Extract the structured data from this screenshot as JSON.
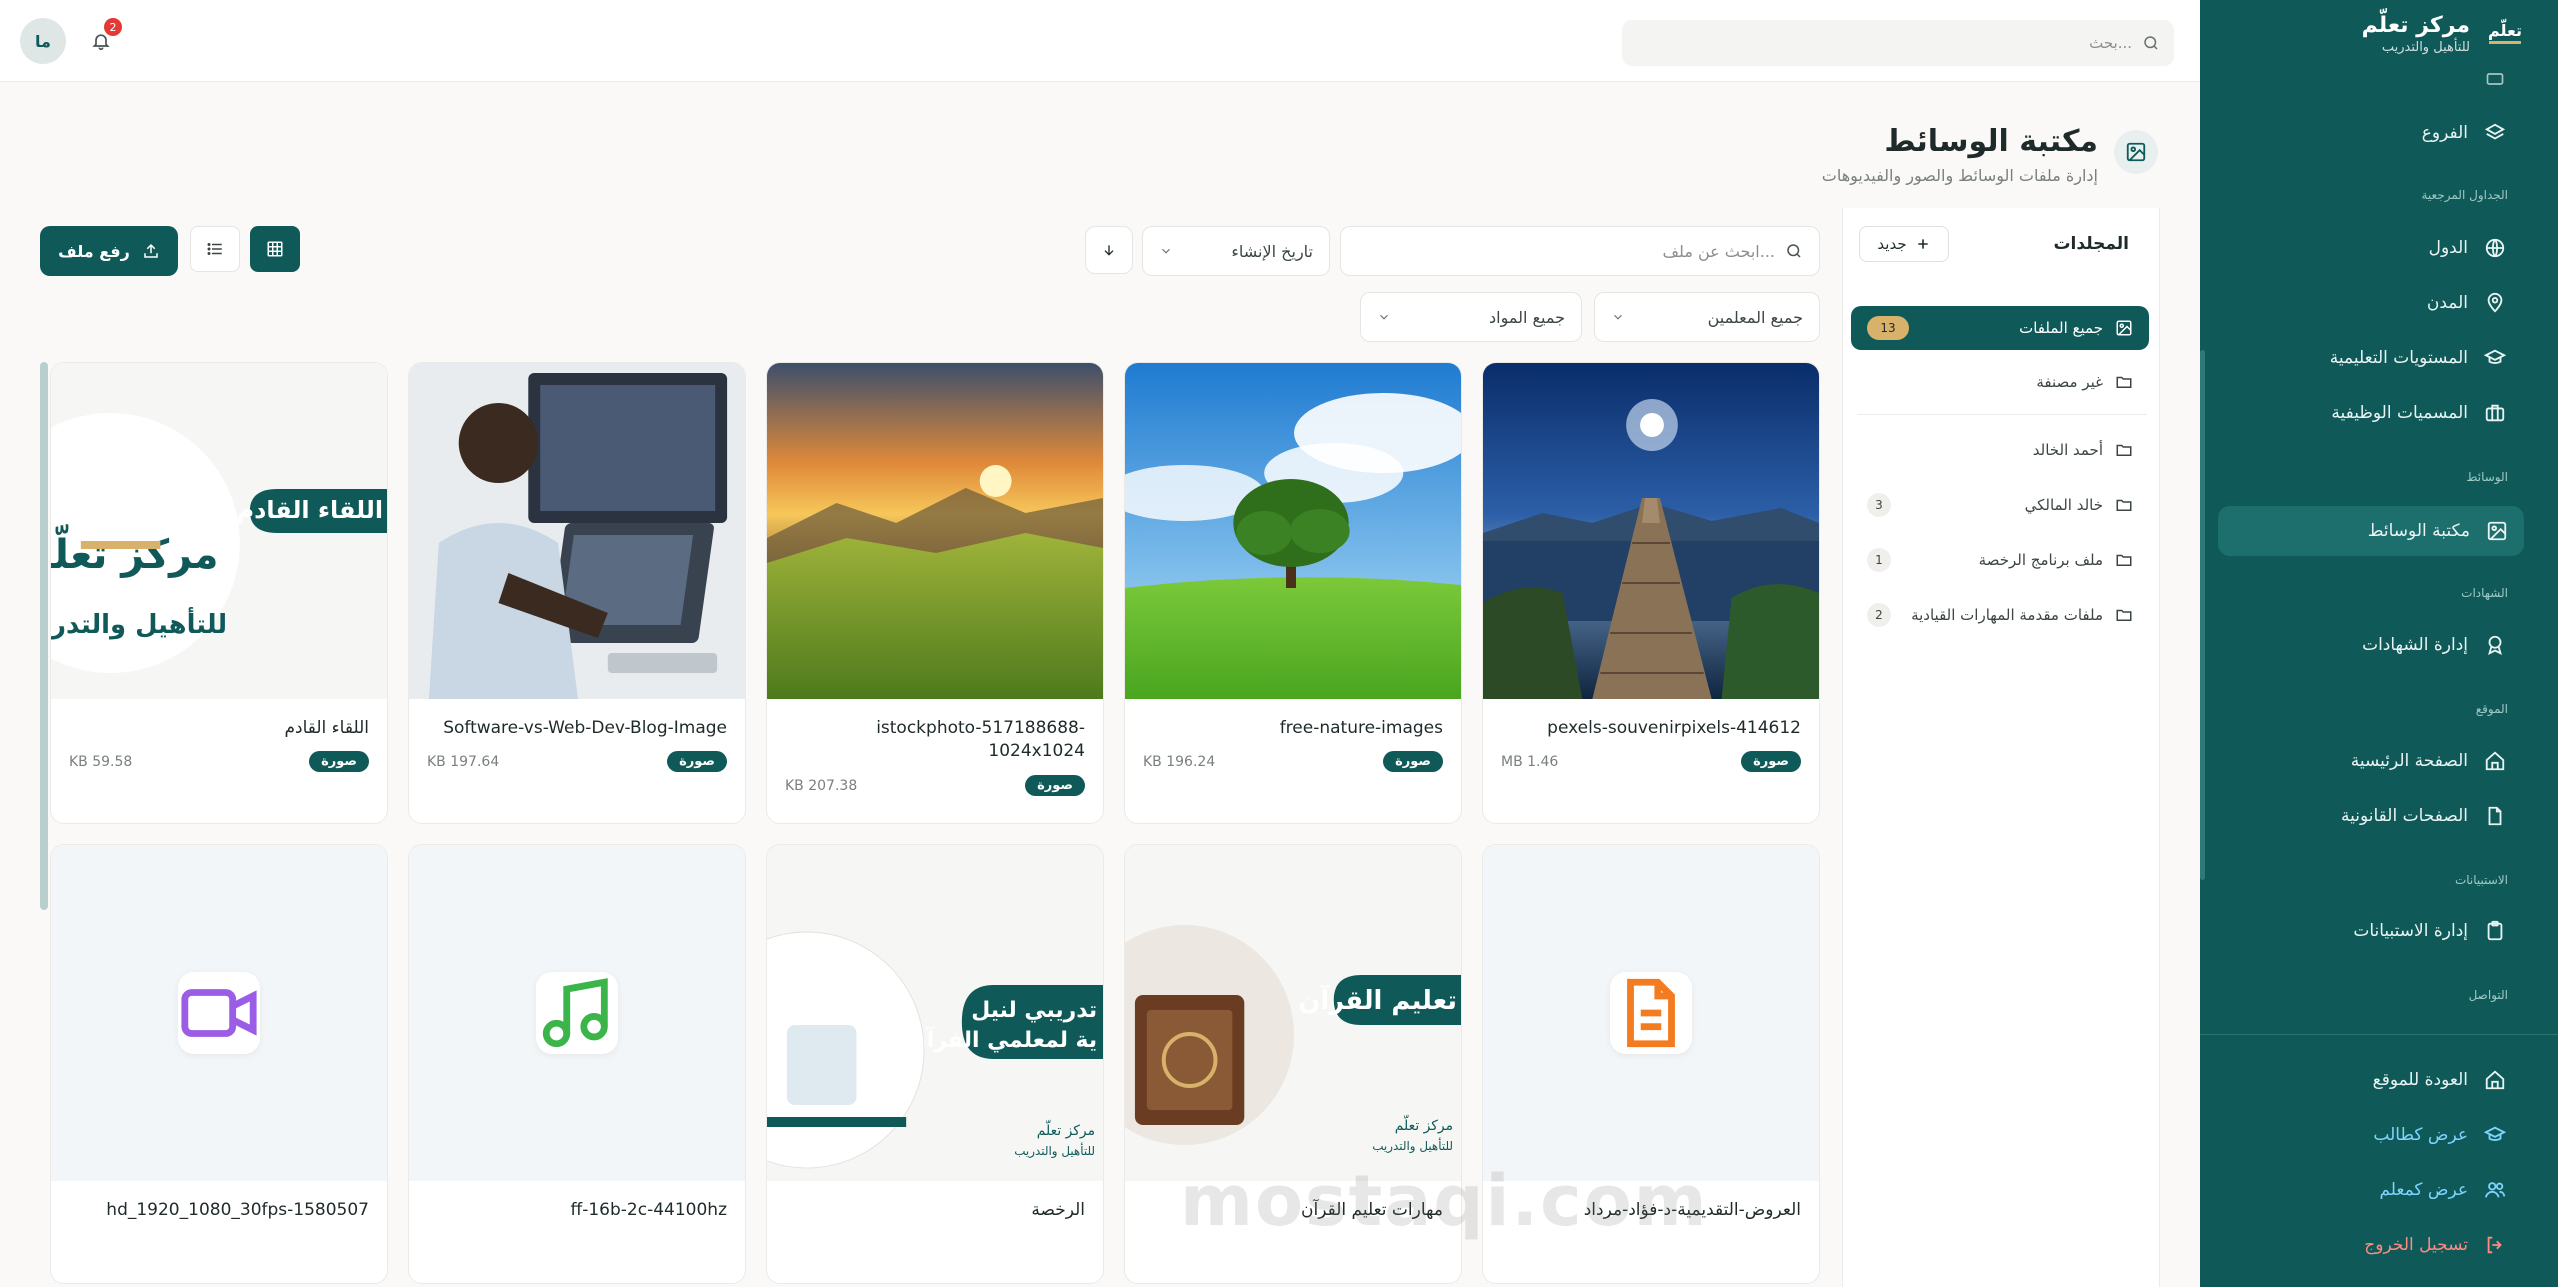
{
  "brand": {
    "title": "مركز تعلّم",
    "subtitle": "للتأهيل والتدريب"
  },
  "sidebar": {
    "items": [
      {
        "label": "الفروع",
        "icon": "layers-icon"
      },
      {
        "label": "الدول",
        "icon": "globe-icon"
      },
      {
        "label": "المدن",
        "icon": "map-pin-icon"
      },
      {
        "label": "المستويات التعليمية",
        "icon": "graduation-cap-icon"
      },
      {
        "label": "المسميات الوظيفية",
        "icon": "briefcase-icon"
      },
      {
        "label": "مكتبة الوسائط",
        "icon": "image-icon",
        "active": true
      },
      {
        "label": "إدارة الشهادات",
        "icon": "award-icon"
      },
      {
        "label": "الصفحة الرئيسية",
        "icon": "home-icon"
      },
      {
        "label": "الصفحات القانونية",
        "icon": "file-icon"
      },
      {
        "label": "إدارة الاستبيانات",
        "icon": "clipboard-icon"
      }
    ],
    "headings": [
      "الجداول المرجعية",
      "الوسائط",
      "الشهادات",
      "الموقع",
      "الاستبيانات",
      "التواصل"
    ],
    "footer": {
      "back": "العودة للموقع",
      "as_student": "عرض كطالب",
      "as_teacher": "عرض كمعلم",
      "logout": "تسجيل الخروج"
    }
  },
  "topbar": {
    "search_placeholder": "بحث...",
    "notifications": "2",
    "avatar": "ما"
  },
  "page": {
    "title": "مكتبة الوسائط",
    "subtitle": "إدارة ملفات الوسائط والصور والفيديوهات"
  },
  "folders": {
    "title": "المجلدات",
    "new_label": "جديد",
    "items": [
      {
        "label": "جميع الملفات",
        "count": "13",
        "active": true
      },
      {
        "label": "غير مصنفة",
        "count": ""
      },
      {
        "label": "أحمد الخالد",
        "count": ""
      },
      {
        "label": "خالد المالكي",
        "count": "3"
      },
      {
        "label": "ملف برنامج الرخصة",
        "count": "1"
      },
      {
        "label": "ملفات مقدمة المهارات القيادية",
        "count": "2"
      }
    ]
  },
  "toolbar": {
    "upload": "رفع ملف",
    "search_placeholder": "ابحث عن ملف...",
    "sort": "تاريخ الإنشاء",
    "teachers": "جميع المعلمين",
    "materials": "جميع المواد"
  },
  "files_row1": [
    {
      "name": "pexels-souvenirpixels-414612",
      "size": "MB 1.46",
      "type": "صورة"
    },
    {
      "name": "free-nature-images",
      "size": "KB 196.24",
      "type": "صورة"
    },
    {
      "name": "istockphoto-517188688-1024x1024",
      "size": "KB 207.38",
      "type": "صورة"
    },
    {
      "name": "Software-vs-Web-Dev-Blog-Image",
      "size": "KB 197.64",
      "type": "صورة"
    },
    {
      "name": "اللقاء القادم",
      "size": "KB 59.58",
      "type": "صورة"
    }
  ],
  "files_row2": [
    {
      "name": "العروض-التقديمية-د-فؤاد-مرداد",
      "kind": "document"
    },
    {
      "name": "مهارات تعليم القرآن",
      "kind": "image"
    },
    {
      "name": "الرخصة",
      "kind": "image"
    },
    {
      "name": "ff-16b-2c-44100hz",
      "kind": "audio"
    },
    {
      "name": "hd_1920_1080_30fps-1580507",
      "kind": "video"
    }
  ],
  "thumb_text": {
    "upcoming": "اللقاء القادم",
    "quran": "تعليم القرآن",
    "license_1": "تدريبي لنيل",
    "license_2": "ية لمعلمي القرآن",
    "logo_ar": "مركز تعلّم",
    "logo_sub": "للتأهيل والتدريب"
  },
  "watermark": "mostaqi.com"
}
